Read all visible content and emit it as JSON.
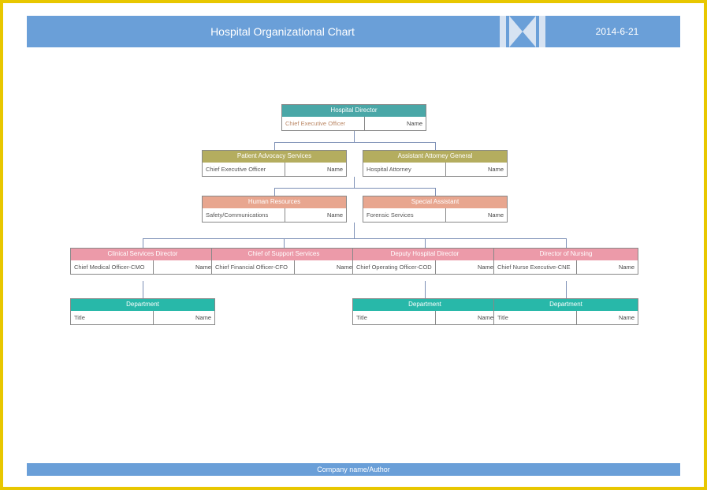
{
  "header": {
    "title": "Hospital Organizational Chart",
    "date": "2014-6-21"
  },
  "chart_data": {
    "type": "org-tree",
    "root": {
      "header": "Hospital Director",
      "role": "Chief Executive Officer",
      "name": "Name",
      "children": [
        {
          "header": "Patient Advocacy Services",
          "role": "Chief Executive Officer",
          "name": "Name"
        },
        {
          "header": "Assistant Attorney General",
          "role": "Hospital Attorney",
          "name": "Name"
        },
        {
          "header": "Human Resources",
          "role": "Safety/Communications",
          "name": "Name"
        },
        {
          "header": "Special Assistant",
          "role": "Forensic Services",
          "name": "Name"
        },
        {
          "header": "Clinical Services Director",
          "role": "Chief Medical Officer-CMO",
          "name": "Name",
          "children": [
            {
              "header": "Department",
              "role": "Title",
              "name": "Name"
            }
          ]
        },
        {
          "header": "Chief of Support Services",
          "role": "Chief Financial Officer-CFO",
          "name": "Name"
        },
        {
          "header": "Deputy Hospital Director",
          "role": "Chief Operating Officer-COD",
          "name": "Name",
          "children": [
            {
              "header": "Department",
              "role": "Title",
              "name": "Name"
            }
          ]
        },
        {
          "header": "Director of Nursing",
          "role": "Chief Nurse Executive-CNE",
          "name": "Name",
          "children": [
            {
              "header": "Department",
              "role": "Title",
              "name": "Name"
            }
          ]
        }
      ]
    }
  },
  "nodes": {
    "root": {
      "header": "Hospital Director",
      "role": "Chief Executive Officer",
      "name": "Name"
    },
    "l2a": {
      "header": "Patient Advocacy Services",
      "role": "Chief Executive Officer",
      "name": "Name"
    },
    "l2b": {
      "header": "Assistant Attorney General",
      "role": "Hospital Attorney",
      "name": "Name"
    },
    "l3a": {
      "header": "Human Resources",
      "role": "Safety/Communications",
      "name": "Name"
    },
    "l3b": {
      "header": "Special Assistant",
      "role": "Forensic Services",
      "name": "Name"
    },
    "l4a": {
      "header": "Clinical Services Director",
      "role": "Chief Medical Officer-CMO",
      "name": "Name"
    },
    "l4b": {
      "header": "Chief of Support Services",
      "role": "Chief Financial Officer-CFO",
      "name": "Name"
    },
    "l4c": {
      "header": "Deputy Hospital Director",
      "role": "Chief Operating Officer-COD",
      "name": "Name"
    },
    "l4d": {
      "header": "Director of Nursing",
      "role": "Chief Nurse Executive-CNE",
      "name": "Name"
    },
    "l5a": {
      "header": "Department",
      "role": "Title",
      "name": "Name"
    },
    "l5b": {
      "header": "Department",
      "role": "Title",
      "name": "Name"
    },
    "l5c": {
      "header": "Department",
      "role": "Title",
      "name": "Name"
    }
  },
  "footer": "Company name/Author"
}
